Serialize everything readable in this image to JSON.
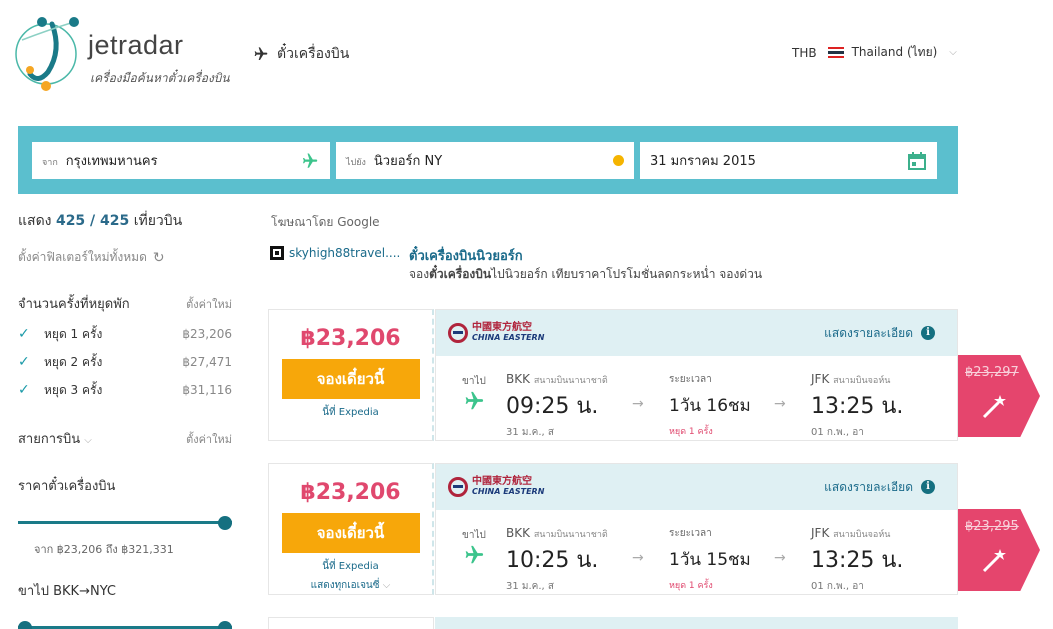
{
  "header": {
    "brand": "jetradar",
    "tagline": "เครื่องมือค้นหาตั๋วเครื่องบิน",
    "nav_flights": "ตั๋วเครื่องบิน",
    "currency": "THB",
    "country": "Thailand (ไทย)"
  },
  "search": {
    "from_label": "จาก",
    "from_value": "กรุงเทพมหานคร",
    "to_label": "ไปยัง",
    "to_value": "นิวยอร์ก NY",
    "date_value": "31 มกราคม 2015"
  },
  "sidebar": {
    "count_prefix": "แสดง",
    "count_value": "425 / 425",
    "count_suffix": "เที่ยวบิน",
    "reset_all": "ตั้งค่าฟิลเตอร์ใหม่ทั้งหมด",
    "stops_title": "จำนวนครั้งที่หยุดพัก",
    "reset_link": "ตั้งค่าใหม่",
    "stops": [
      {
        "label": "หยุด 1 ครั้ง",
        "price": "฿23,206"
      },
      {
        "label": "หยุด 2 ครั้ง",
        "price": "฿27,471"
      },
      {
        "label": "หยุด 3 ครั้ง",
        "price": "฿31,116"
      }
    ],
    "airlines_title": "สายการบิน",
    "price_title": "ราคาตั๋วเครื่องบิน",
    "price_range": "จาก ฿23,206 ถึง ฿321,331",
    "price_slider": {
      "min": 23206,
      "max": 321331,
      "low": 23206,
      "high": 321331
    },
    "outbound_title": "ขาไป BKK→NYC"
  },
  "ads": {
    "label": "โฆษณาโดย Google",
    "domain": "skyhigh88travel....",
    "title": "ตั๋วเครื่องบินนิวยอร์ก",
    "desc_pre": "จอง",
    "desc_bold": "ตั๋วเครื่องบิน",
    "desc_post": "ไปนิวยอร์ก เทียบราคาโปรโมชั่นลดกระหน่ำ จองด่วน"
  },
  "results": [
    {
      "price": "฿23,206",
      "book_label": "จองเดี๋ยวนี้",
      "source": "นี้ที่ Expedia",
      "agencies": "",
      "airline_cn": "中國東方航空",
      "airline_en": "CHINA EASTERN",
      "details": "แสดงรายละเอียด",
      "direction": "ขาไป",
      "dep_code": "BKK",
      "dep_airport": "สนามบินนานาชาติ",
      "dep_time": "09:25 น.",
      "dep_date": "31 ม.ค., ส",
      "dur_label": "ระยะเวลา",
      "duration": "1วัน 16ชม",
      "stops": "หยุด 1 ครั้ง",
      "arr_code": "JFK",
      "arr_airport": "สนามบินจอห์น",
      "arr_time": "13:25 น.",
      "arr_date": "01 ก.พ., อา",
      "old_price": "฿23,297"
    },
    {
      "price": "฿23,206",
      "book_label": "จองเดี๋ยวนี้",
      "source": "นี้ที่ Expedia",
      "agencies": "แสดงทุกเอเจนซี่",
      "airline_cn": "中國東方航空",
      "airline_en": "CHINA EASTERN",
      "details": "แสดงรายละเอียด",
      "direction": "ขาไป",
      "dep_code": "BKK",
      "dep_airport": "สนามบินนานาชาติ",
      "dep_time": "10:25 น.",
      "dep_date": "31 ม.ค., ส",
      "dur_label": "ระยะเวลา",
      "duration": "1วัน 15ชม",
      "stops": "หยุด 1 ครั้ง",
      "arr_code": "JFK",
      "arr_airport": "สนามบินจอห์น",
      "arr_time": "13:25 น.",
      "arr_date": "01 ก.พ., อา",
      "old_price": "฿23,295"
    }
  ],
  "colors": {
    "brand_teal": "#5bbfce",
    "accent_pink": "#e0486e",
    "book_orange": "#f7a70a",
    "link_blue": "#1a6a8a"
  }
}
